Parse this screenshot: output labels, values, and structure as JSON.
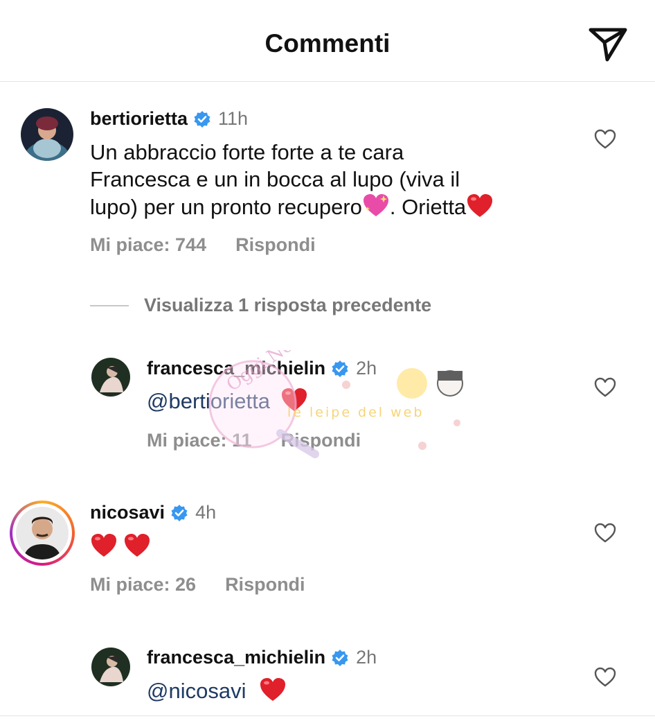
{
  "header": {
    "title": "Commenti",
    "share_icon": "paper-plane-icon"
  },
  "comments": [
    {
      "username": "bertiorietta",
      "time": "11h",
      "text_part1": "Un abbraccio forte forte a te cara",
      "text_part2": "Francesca e un in bocca al lupo (viva il",
      "text_part3": "lupo) per un pronto recupero",
      "text_part4": ". Orietta",
      "likes": "Mi piace: 744",
      "reply": "Rispondi",
      "view_replies": "Visualizza 1 risposta precedente"
    },
    {
      "username": "francesca_michielin",
      "time": "2h",
      "mention": "@bertiorietta",
      "likes": "Mi piace: 11",
      "reply": "Rispondi"
    },
    {
      "username": "nicosavi",
      "time": "4h",
      "likes": "Mi piace: 26",
      "reply": "Rispondi"
    },
    {
      "username": "francesca_michielin",
      "time": "2h",
      "mention": "@nicosavi"
    }
  ],
  "colors": {
    "verified": "#3897f0",
    "heart": "#e0202a",
    "meta": "#8e8e8e",
    "mention": "#1f3a63"
  },
  "watermark": {
    "text1": "Oggi News",
    "text2": "le leipe del web"
  }
}
